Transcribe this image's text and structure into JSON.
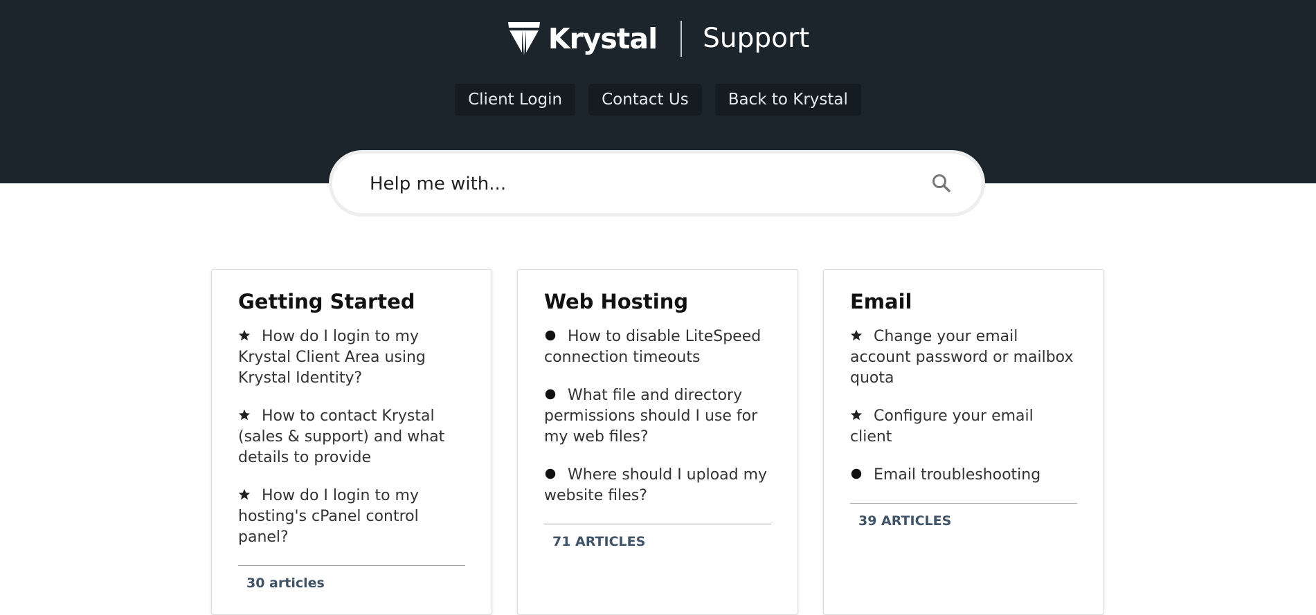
{
  "header": {
    "brand": "Krystal",
    "section": "Support",
    "nav": [
      {
        "label": "Client Login"
      },
      {
        "label": "Contact Us"
      },
      {
        "label": "Back to Krystal"
      }
    ]
  },
  "search": {
    "placeholder": "Help me with..."
  },
  "categories": [
    {
      "title": "Getting Started",
      "articles": [
        {
          "icon": "star-icon",
          "text": "How do I login to my Krystal Client Area using Krystal Identity?"
        },
        {
          "icon": "star-icon",
          "text": "How to contact Krystal (sales & support) and what details to provide"
        },
        {
          "icon": "star-icon",
          "text": "How do I login to my hosting's cPanel control panel?"
        }
      ],
      "count_label": "30 articles"
    },
    {
      "title": "Web Hosting",
      "articles": [
        {
          "icon": "dot-icon",
          "text": "How to disable LiteSpeed connection timeouts"
        },
        {
          "icon": "dot-icon",
          "text": "What file and directory permissions should I use for my web files?"
        },
        {
          "icon": "dot-icon",
          "text": "Where should I upload my website files?"
        }
      ],
      "count_label": "71 ARTICLES"
    },
    {
      "title": "Email",
      "articles": [
        {
          "icon": "star-icon",
          "text": "Change your email account password or mailbox quota"
        },
        {
          "icon": "star-icon",
          "text": "Configure your email client"
        },
        {
          "icon": "dot-icon",
          "text": "Email troubleshooting"
        }
      ],
      "count_label": "39 ARTICLES"
    }
  ],
  "colors": {
    "header_bg": "#1c252c",
    "nav_button_bg": "#141b21",
    "article_count": "#3f5468"
  }
}
